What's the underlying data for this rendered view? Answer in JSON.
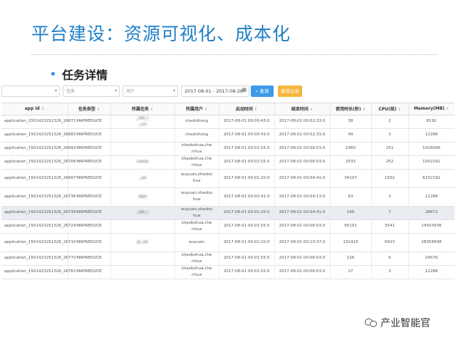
{
  "slide": {
    "title": "平台建设：资源可视化、成本化",
    "bullet": "任务详情"
  },
  "filters": {
    "select1": "",
    "select2": "任务",
    "select3": "用户",
    "date_range": "2017-08-01 - 2017-08-28",
    "search_label": "查询",
    "export_label": "跳转记录"
  },
  "table": {
    "columns": [
      "app id",
      "任务类型",
      "所属任务",
      "所属用户",
      "启动时间",
      "结束时间",
      "使用时长(秒)",
      "CPU(核)",
      "Memory(MB)"
    ],
    "rows": [
      {
        "app_id": "application_1501423251326_26671",
        "type": "MAPREDUCE",
        "task": "_ads_r\n_cnt",
        "user": "chezhihong",
        "start": "2017-08-01 00:00:43.0",
        "end": "2017-08-01 00:02:33.0",
        "duration": "38",
        "cpu": "2",
        "memory": "8192"
      },
      {
        "app_id": "application_1501423251326_26683",
        "type": "MAPREDUCE",
        "task": "",
        "user": "chezhihong",
        "start": "2017-08-01 00:00:43.0",
        "end": "2017-08-01 00:02:33.0",
        "duration": "49",
        "cpu": "3",
        "memory": "12288"
      },
      {
        "app_id": "application_1501423251326_26693",
        "type": "MAPREDUCE",
        "task": "",
        "user": "zhaobohua,che\nnhua",
        "start": "2017-08-01 00:01:55.0",
        "end": "2017-08-01 00:06:03.0",
        "duration": "2360",
        "cpu": "251",
        "memory": "1026096"
      },
      {
        "app_id": "application_1501423251326_26706",
        "type": "MAPREDUCE",
        "task": "rowse",
        "user": "zhaobohua,che\nnhua",
        "start": "2017-08-01 00:01:55.0",
        "end": "2017-08-01 00:06:03.0",
        "duration": "2533",
        "cpu": "252",
        "memory": "1032192"
      },
      {
        "app_id": "application_1501423251326_26687",
        "type": "MAPREDUCE",
        "task": "_ad",
        "user": "wuyuan,zhaobo\nhua",
        "start": "2017-08-01 00:01:20.0",
        "end": "2017-08-01 00:04:41.0",
        "duration": "34107",
        "cpu": "1502",
        "memory": "6152192"
      },
      {
        "app_id": "application_1501423251326_26736",
        "type": "MAPREDUCE",
        "task": "appl",
        "user": "wuyuan,zhaobo\nhua",
        "start": "2017-08-01 00:02:41.0",
        "end": "2017-08-01 00:04:13.0",
        "duration": "63",
        "cpu": "3",
        "memory": "12288"
      },
      {
        "app_id": "application_1501423251326_26739",
        "type": "MAPREDUCE",
        "task": "_ads_r",
        "user": "wuyuan,zhaobo\nhua",
        "start": "2017-08-01 00:01:20.0",
        "end": "2017-08-01 00:04:41.0",
        "duration": "169",
        "cpu": "7",
        "memory": "28672"
      },
      {
        "app_id": "application_1501423251326_26724",
        "type": "MAPREDUCE",
        "task": "",
        "user": "zhaobohua,che\nnhua",
        "start": "2017-08-01 00:01:55.0",
        "end": "2017-08-01 00:06:03.0",
        "duration": "95191",
        "cpu": "3541",
        "memory": "14503936"
      },
      {
        "app_id": "application_1501423251326_26710",
        "type": "MAPREDUCE",
        "task": "pt_ski",
        "user": "wuyuan",
        "start": "2017-08-01 00:02:20.0",
        "end": "2017-08-01 00:10:37.0",
        "duration": "131415",
        "cpu": "6923",
        "memory": "28356608"
      },
      {
        "app_id": "application_1501423251326_26770",
        "type": "MAPREDUCE",
        "task": "",
        "user": "zhaobohua,che\nnhua",
        "start": "2017-08-01 00:01:55.0",
        "end": "2017-08-01 00:06:03.0",
        "duration": "126",
        "cpu": "6",
        "memory": "24576"
      },
      {
        "app_id": "application_1501423251326_26763",
        "type": "MAPREDUCE",
        "task": "",
        "user": "zhaobohua,che\nnhua",
        "start": "2017-08-01 00:01:55.0",
        "end": "2017-08-01 00:06:03.0",
        "duration": "27",
        "cpu": "3",
        "memory": "12288"
      }
    ]
  },
  "watermark": {
    "text": "产业智能官",
    "icon": "wechat-icon"
  }
}
